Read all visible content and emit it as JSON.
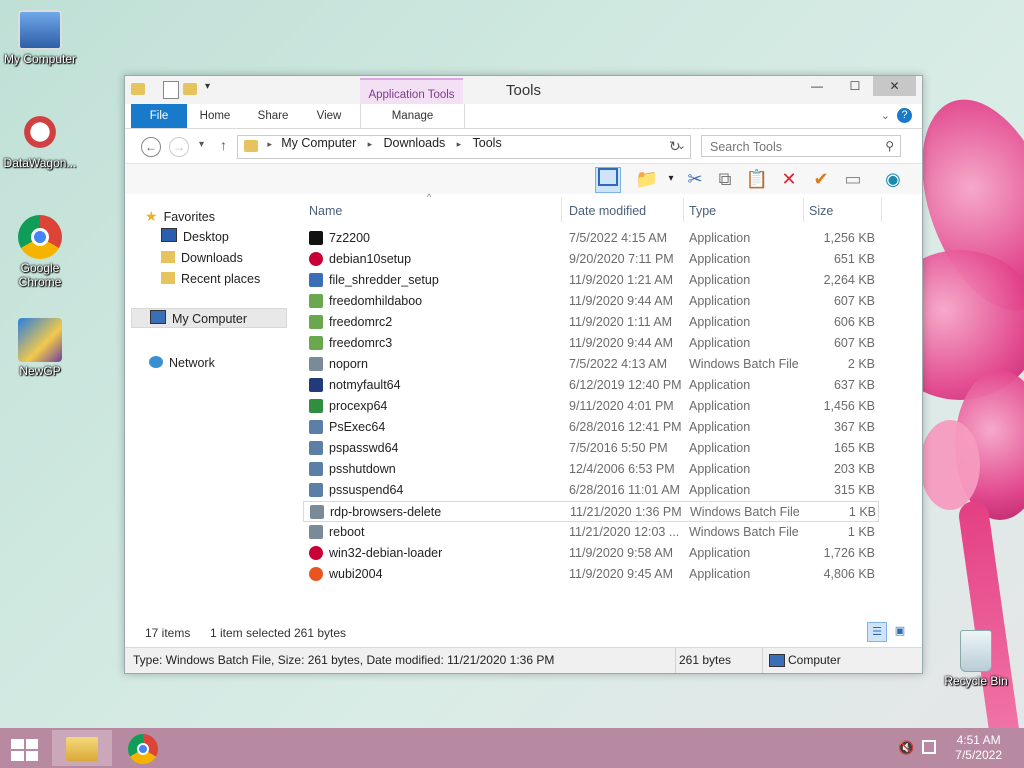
{
  "desktop": {
    "icons": [
      {
        "label": "My Computer",
        "icon": "computer-icon"
      },
      {
        "label": "DataWagon...",
        "icon": "datawagon-icon"
      },
      {
        "label": "Google Chrome",
        "icon": "chrome-icon"
      },
      {
        "label": "NewGP",
        "icon": "newgp-icon"
      },
      {
        "label": "Recycle Bin",
        "icon": "recycle-bin-icon"
      }
    ]
  },
  "window": {
    "title": "Tools",
    "contextual_tab": "Application Tools",
    "buttons": {
      "minimize": "—",
      "maximize": "☐",
      "close": "✕"
    },
    "ribbon_tabs": [
      "File",
      "Home",
      "Share",
      "View",
      "Manage"
    ],
    "address": {
      "crumbs": [
        "My Computer",
        "Downloads",
        "Tools"
      ]
    },
    "search": {
      "placeholder": "Search Tools"
    },
    "columns": [
      "Name",
      "Date modified",
      "Type",
      "Size"
    ],
    "nav": {
      "favorites": "Favorites",
      "favorites_items": [
        "Desktop",
        "Downloads",
        "Recent places"
      ],
      "computer": "My Computer",
      "network": "Network"
    },
    "files": [
      {
        "name": "7z2200",
        "date": "7/5/2022 4:15 AM",
        "type": "Application",
        "size": "1,256 KB",
        "icon": "7zip-icon"
      },
      {
        "name": "debian10setup",
        "date": "9/20/2020 7:11 PM",
        "type": "Application",
        "size": "651 KB",
        "icon": "debian-icon"
      },
      {
        "name": "file_shredder_setup",
        "date": "11/9/2020 1:21 AM",
        "type": "Application",
        "size": "2,264 KB",
        "icon": "installer-icon"
      },
      {
        "name": "freedomhildaboo",
        "date": "11/9/2020 9:44 AM",
        "type": "Application",
        "size": "607 KB",
        "icon": "freedom-icon"
      },
      {
        "name": "freedomrc2",
        "date": "11/9/2020 1:11 AM",
        "type": "Application",
        "size": "606 KB",
        "icon": "freedom-icon"
      },
      {
        "name": "freedomrc3",
        "date": "11/9/2020 9:44 AM",
        "type": "Application",
        "size": "607 KB",
        "icon": "freedom-icon"
      },
      {
        "name": "noporn",
        "date": "7/5/2022 4:13 AM",
        "type": "Windows Batch File",
        "size": "2 KB",
        "icon": "batch-file-icon"
      },
      {
        "name": "notmyfault64",
        "date": "6/12/2019 12:40 PM",
        "type": "Application",
        "size": "637 KB",
        "icon": "notmyfault-icon"
      },
      {
        "name": "procexp64",
        "date": "9/11/2020 4:01 PM",
        "type": "Application",
        "size": "1,456 KB",
        "icon": "procexp-icon"
      },
      {
        "name": "PsExec64",
        "date": "6/28/2016 12:41 PM",
        "type": "Application",
        "size": "367 KB",
        "icon": "app-window-icon"
      },
      {
        "name": "pspasswd64",
        "date": "7/5/2016 5:50 PM",
        "type": "Application",
        "size": "165 KB",
        "icon": "app-window-icon"
      },
      {
        "name": "psshutdown",
        "date": "12/4/2006 6:53 PM",
        "type": "Application",
        "size": "203 KB",
        "icon": "app-window-icon"
      },
      {
        "name": "pssuspend64",
        "date": "6/28/2016 11:01 AM",
        "type": "Application",
        "size": "315 KB",
        "icon": "app-window-icon"
      },
      {
        "name": "rdp-browsers-delete",
        "date": "11/21/2020 1:36 PM",
        "type": "Windows Batch File",
        "size": "1 KB",
        "icon": "batch-file-icon"
      },
      {
        "name": "reboot",
        "date": "11/21/2020 12:03 ...",
        "type": "Windows Batch File",
        "size": "1 KB",
        "icon": "batch-file-icon"
      },
      {
        "name": "win32-debian-loader",
        "date": "11/9/2020 9:58 AM",
        "type": "Application",
        "size": "1,726 KB",
        "icon": "debian-icon"
      },
      {
        "name": "wubi2004",
        "date": "11/9/2020 9:45 AM",
        "type": "Application",
        "size": "4,806 KB",
        "icon": "ubuntu-icon"
      }
    ],
    "status": {
      "count": "17 items",
      "selected": "1 item selected",
      "selected_size": "261 bytes"
    },
    "details": {
      "info": "Type: Windows Batch File, Size: 261 bytes, Date modified: 11/21/2020 1:36 PM",
      "size": "261 bytes",
      "location": "Computer"
    }
  },
  "taskbar": {
    "time": "4:51 AM",
    "date": "7/5/2022"
  },
  "colors": {
    "accent": "#1979ca",
    "taskbar": "#b88aa2",
    "context_tab": "#f3e0f5"
  }
}
